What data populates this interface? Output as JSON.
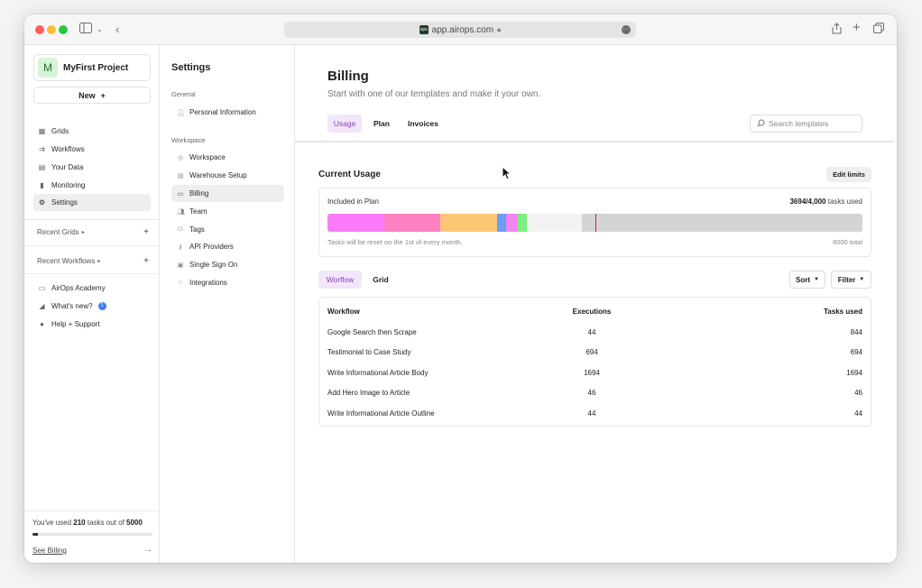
{
  "browser": {
    "url": "app.airops.com",
    "favicon": "ops"
  },
  "sidebar": {
    "project": {
      "avatar": "M",
      "name": "MyFirst Project"
    },
    "new_label": "New",
    "nav": [
      {
        "label": "Grids",
        "icon": "grid-icon"
      },
      {
        "label": "Workflows",
        "icon": "workflow-icon"
      },
      {
        "label": "Your Data",
        "icon": "data-icon"
      },
      {
        "label": "Monitoring",
        "icon": "chart-icon"
      },
      {
        "label": "Settings",
        "icon": "gear-icon",
        "active": true
      }
    ],
    "recent_grids": "Recent Grids",
    "recent_workflows": "Recent Workflows",
    "links": [
      {
        "label": "AirOps Academy",
        "icon": "book-icon"
      },
      {
        "label": "What's new?",
        "icon": "megaphone-icon",
        "badge": "1"
      },
      {
        "label": "Help + Support",
        "icon": "help-icon"
      }
    ],
    "usage": {
      "prefix": "You've used",
      "used": "210",
      "middle": "tasks out of",
      "total": "5000",
      "fraction": 0.042,
      "link": "See Billing"
    }
  },
  "settings": {
    "title": "Settings",
    "general_label": "General",
    "general": [
      {
        "label": "Personal Information",
        "icon": "person-icon"
      }
    ],
    "workspace_label": "Workspace",
    "workspace": [
      {
        "label": "Workspace",
        "icon": "workspace-icon"
      },
      {
        "label": "Warehouse Setup",
        "icon": "warehouse-icon"
      },
      {
        "label": "Billing",
        "icon": "card-icon",
        "active": true
      },
      {
        "label": "Team",
        "icon": "team-icon"
      },
      {
        "label": "Tags",
        "icon": "tag-icon"
      },
      {
        "label": "API Providers",
        "icon": "key-icon"
      },
      {
        "label": "Single Sign On",
        "icon": "lock-icon"
      },
      {
        "label": "Integrations",
        "icon": "integration-icon"
      }
    ]
  },
  "billing": {
    "title": "Billing",
    "subtitle": "Start with one of our templates and make it your own.",
    "tabs": [
      "Usage",
      "Plan",
      "Invoices"
    ],
    "search_placeholder": "Search templates",
    "current_usage": "Current Usage",
    "edit_limits": "Edit limits",
    "included_label": "Included in Plan",
    "used_value": "3694/4,000",
    "used_suffix": "tasks used",
    "reset_note": "Tasks will be reset on the 1st of every month.",
    "total_note": "8000 total",
    "bar_total": 8000,
    "plan_limit": 4000,
    "segments": [
      {
        "value": 844,
        "color": "#fb7bfb"
      },
      {
        "value": 844,
        "color": "#fb82c0"
      },
      {
        "value": 844,
        "color": "#fdc675"
      },
      {
        "value": 140,
        "color": "#6b9cf6"
      },
      {
        "value": 170,
        "color": "#f285f5"
      },
      {
        "value": 140,
        "color": "#7cf07c"
      },
      {
        "value": 818,
        "color": "#f2f2f2"
      }
    ],
    "view_tabs": [
      "Worflow",
      "Grid"
    ],
    "sort_label": "Sort",
    "filter_label": "Filter",
    "table": {
      "headers": [
        "Workflow",
        "Executions",
        "Tasks used"
      ],
      "rows": [
        [
          "Google Search then Scrape",
          "44",
          "844"
        ],
        [
          "Testimonial to Case Study",
          "694",
          "694"
        ],
        [
          "Write Informational Article Body",
          "1694",
          "1694"
        ],
        [
          "Add Hero Image to Article",
          "46",
          "46"
        ],
        [
          "Write Informational Article Outline",
          "44",
          "44"
        ]
      ]
    }
  }
}
